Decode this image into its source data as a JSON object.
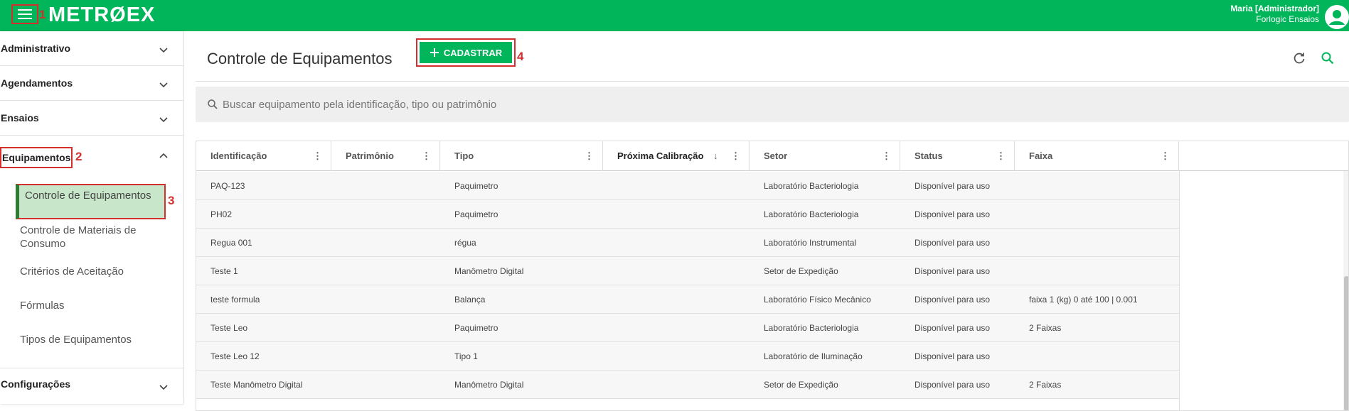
{
  "topbar": {
    "logo": "METRØEX",
    "user_name": "Maria [Administrador]",
    "user_company": "Forlogic Ensaios",
    "annotation": "1"
  },
  "sidebar": {
    "sections": [
      {
        "label": "Administrativo"
      },
      {
        "label": "Agendamentos"
      },
      {
        "label": "Ensaios"
      },
      {
        "label": "Equipamentos",
        "annotation": "2"
      },
      {
        "label": "Configurações"
      }
    ],
    "equipamentos_items": [
      {
        "label": "Controle de Equipamentos",
        "annotation": "3"
      },
      {
        "label": "Controle de Materiais de Consumo"
      },
      {
        "label": "Critérios de Aceitação"
      },
      {
        "label": "Fórmulas"
      },
      {
        "label": "Tipos de Equipamentos"
      }
    ]
  },
  "main": {
    "title": "Controle de Equipamentos",
    "add_button": "CADASTRAR",
    "add_annotation": "4",
    "search_placeholder": "Buscar equipamento pela identificação, tipo ou patrimônio"
  },
  "table": {
    "columns": [
      "Identificação",
      "Patrimônio",
      "Tipo",
      "Próxima Calibração",
      "Setor",
      "Status",
      "Faixa"
    ],
    "rows": [
      [
        "PAQ-123",
        "",
        "Paquimetro",
        "",
        "Laboratório Bacteriologia",
        "Disponível para uso",
        ""
      ],
      [
        "PH02",
        "",
        "Paquimetro",
        "",
        "Laboratório Bacteriologia",
        "Disponível para uso",
        ""
      ],
      [
        "Regua 001",
        "",
        "régua",
        "",
        "Laboratório Instrumental",
        "Disponível para uso",
        ""
      ],
      [
        "Teste 1",
        "",
        "Manômetro Digital",
        "",
        "Setor de Expedição",
        "Disponível para uso",
        ""
      ],
      [
        "teste formula",
        "",
        "Balança",
        "",
        "Laboratório Físico Mecânico",
        "Disponível para uso",
        "faixa 1 (kg) 0 até 100 | 0.001"
      ],
      [
        "Teste Leo",
        "",
        "Paquimetro",
        "",
        "Laboratório Bacteriologia",
        "Disponível para uso",
        "2 Faixas"
      ],
      [
        "Teste Leo 12",
        "",
        "Tipo 1",
        "",
        "Laboratório de Iluminação",
        "Disponível para uso",
        ""
      ],
      [
        "Teste Manômetro Digital",
        "",
        "Manômetro Digital",
        "",
        "Setor de Expedição",
        "Disponível para uso",
        "2 Faixas"
      ]
    ]
  },
  "colors": {
    "brand": "#00b55a",
    "annotation": "#d32f2f",
    "active_bg": "#c8e6c9"
  }
}
